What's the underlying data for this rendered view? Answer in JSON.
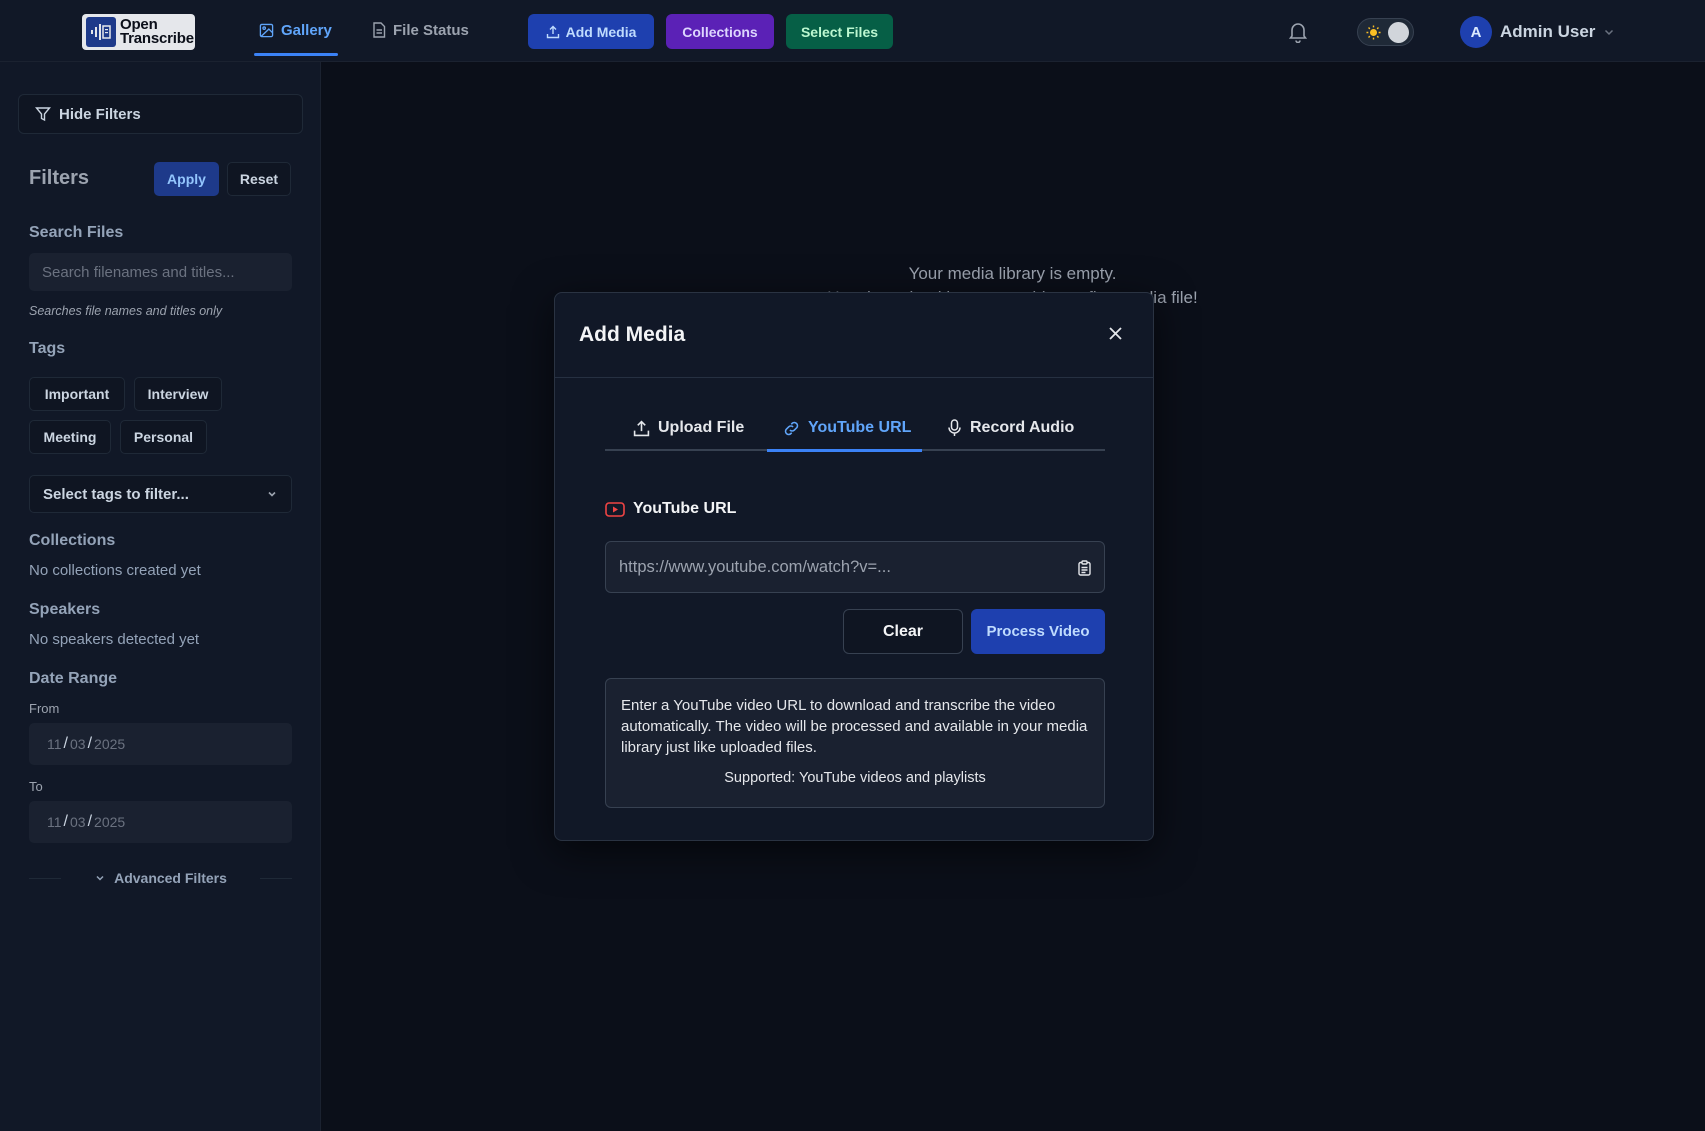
{
  "navbar": {
    "logo_line1": "Open",
    "logo_line2": "Transcribe",
    "links": [
      {
        "label": "Gallery",
        "active": true,
        "icon": "image-icon"
      },
      {
        "label": "File Status",
        "active": false,
        "icon": "file-icon"
      }
    ],
    "buttons": {
      "add_media": "Add Media",
      "collections": "Collections",
      "select_files": "Select Files"
    },
    "user": {
      "initial": "A",
      "name": "Admin User"
    }
  },
  "sidebar": {
    "hide_filters": "Hide Filters",
    "filters_title": "Filters",
    "apply": "Apply",
    "reset": "Reset",
    "search_heading": "Search Files",
    "search_placeholder": "Search filenames and titles...",
    "search_note": "Searches file names and titles only",
    "tags_heading": "Tags",
    "tags": [
      "Important",
      "Interview",
      "Meeting",
      "Personal"
    ],
    "tags_select": "Select tags to filter...",
    "collections_heading": "Collections",
    "collections_empty": "No collections created yet",
    "speakers_heading": "Speakers",
    "speakers_empty": "No speakers detected yet",
    "date_heading": "Date Range",
    "from_label": "From",
    "to_label": "To",
    "from_date": {
      "mm": "11",
      "dd": "03",
      "yyyy": "2025"
    },
    "to_date": {
      "mm": "11",
      "dd": "03",
      "yyyy": "2025"
    },
    "advanced": "Advanced Filters"
  },
  "main": {
    "empty_line1": "Your media library is empty.",
    "empty_line2": "Use the upload button to add your first media file!"
  },
  "modal": {
    "title": "Add Media",
    "tabs": [
      {
        "label": "Upload File",
        "active": false
      },
      {
        "label": "YouTube URL",
        "active": true
      },
      {
        "label": "Record Audio",
        "active": false
      }
    ],
    "url_label": "YouTube URL",
    "url_placeholder": "https://www.youtube.com/watch?v=...",
    "clear": "Clear",
    "process": "Process Video",
    "info": "Enter a YouTube video URL to download and transcribe the video automatically. The video will be processed and available in your media library just like uploaded files.",
    "supported": "Supported: YouTube videos and playlists"
  },
  "colors": {
    "accent": "#3b82f6",
    "add_media_bg": "#1e40af",
    "collections_bg": "#5b21b6",
    "select_files_bg": "#065f46",
    "youtube_red": "#ef4444"
  }
}
